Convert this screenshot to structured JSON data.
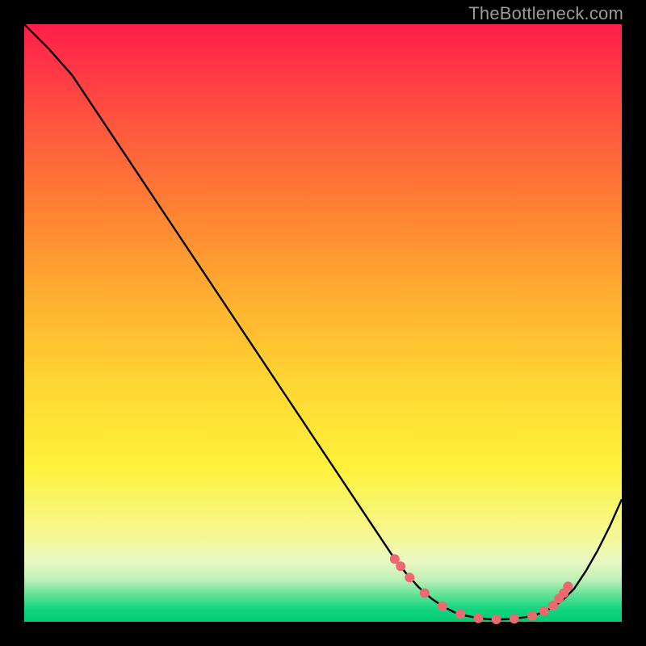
{
  "branding": {
    "watermark": "TheBottleneck.com"
  },
  "chart_data": {
    "type": "line",
    "title": "",
    "xlabel": "",
    "ylabel": "",
    "xlim": [
      0,
      100
    ],
    "ylim": [
      0,
      100
    ],
    "grid": false,
    "legend": false,
    "series": [
      {
        "name": "curve",
        "color": "#000000",
        "x": [
          0,
          4,
          8,
          12,
          16,
          20,
          24,
          28,
          32,
          36,
          40,
          44,
          48,
          52,
          56,
          60,
          62,
          64,
          66,
          68,
          70,
          72,
          74,
          76,
          78,
          80,
          82,
          84,
          86,
          88,
          90,
          92,
          94,
          96,
          98,
          100
        ],
        "y": [
          100,
          96,
          91.5,
          85.5,
          79.5,
          73.5,
          67.5,
          61.5,
          55.5,
          49.5,
          43.5,
          37.5,
          31.5,
          25.5,
          19.5,
          13.5,
          10.5,
          8.0,
          5.8,
          4.0,
          2.6,
          1.6,
          1.0,
          0.6,
          0.4,
          0.4,
          0.5,
          0.8,
          1.3,
          2.2,
          3.5,
          5.5,
          8.5,
          12.0,
          16.0,
          20.5
        ]
      }
    ],
    "markers": {
      "name": "highlight-points",
      "color": "#ec6a6f",
      "radius_px": 6,
      "x": [
        62,
        63,
        64.5,
        67,
        70,
        73,
        76,
        79,
        82,
        85,
        87,
        88.5,
        89.5,
        90.3,
        91
      ],
      "y": [
        10.5,
        9.3,
        7.4,
        4.8,
        2.6,
        1.3,
        0.6,
        0.4,
        0.5,
        1.0,
        1.8,
        2.7,
        3.9,
        4.8,
        5.9
      ]
    },
    "background": {
      "type": "vertical-gradient",
      "stops": [
        {
          "pct": 0,
          "color": "#ff1e4a"
        },
        {
          "pct": 18,
          "color": "#ff5a3e"
        },
        {
          "pct": 46,
          "color": "#ffb030"
        },
        {
          "pct": 74,
          "color": "#fff23a"
        },
        {
          "pct": 90,
          "color": "#e9f8c4"
        },
        {
          "pct": 100,
          "color": "#04c971"
        }
      ]
    }
  }
}
